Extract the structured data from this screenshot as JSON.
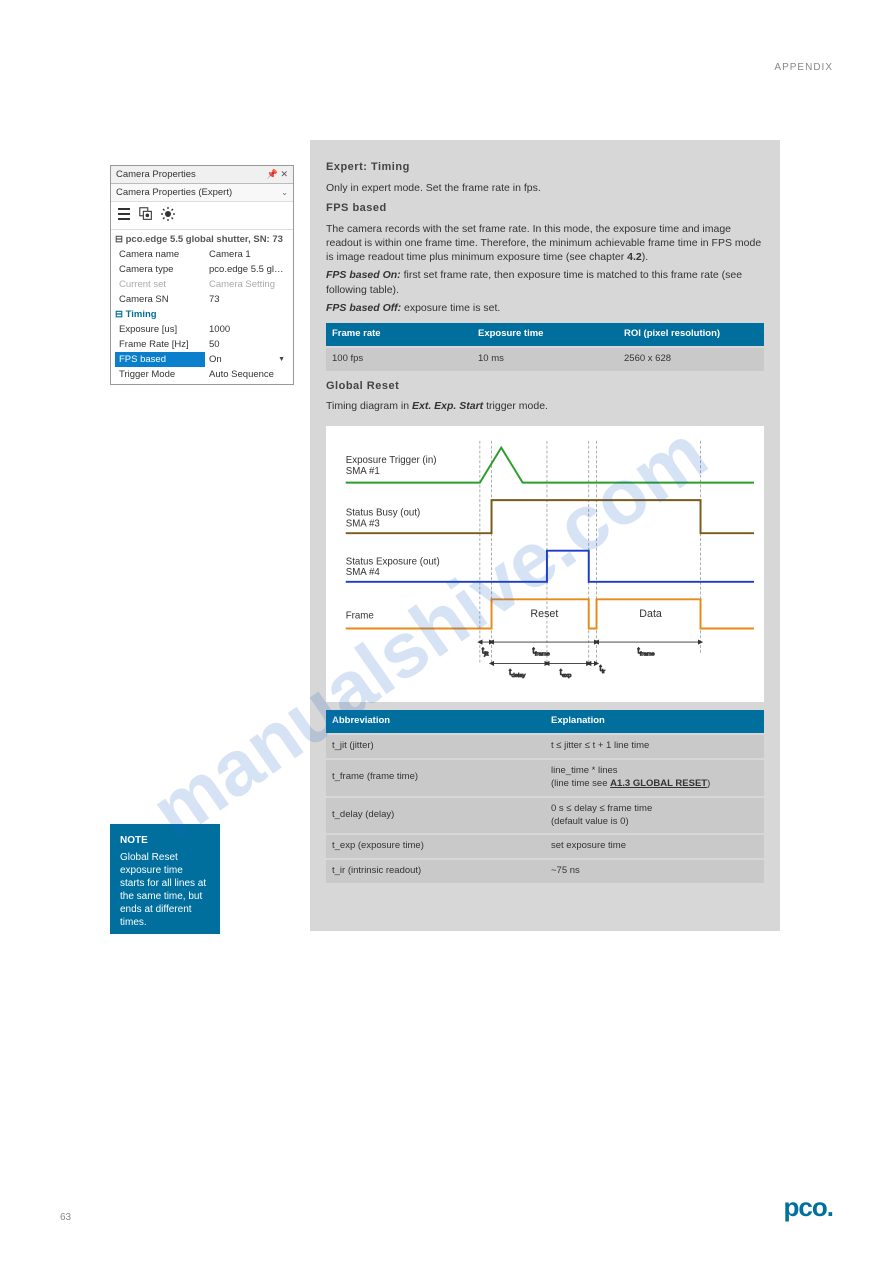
{
  "header": {
    "section_label": "APPENDIX"
  },
  "prop_panel": {
    "title": "Camera Properties",
    "dropdown": "Camera Properties (Expert)",
    "group1_head": "pco.edge 5.5 global shutter, SN: 73",
    "rows1": [
      {
        "label": "Camera name",
        "value": "Camera 1"
      },
      {
        "label": "Camera type",
        "value": "pco.edge 5.5 global..."
      },
      {
        "label": "Current set",
        "value": "Camera Setting",
        "gray": true
      },
      {
        "label": "Camera SN",
        "value": "73"
      }
    ],
    "group2_head": "Timing",
    "rows2": [
      {
        "label": "Exposure [us]",
        "value": "1000"
      },
      {
        "label": "Frame Rate [Hz]",
        "value": "50"
      },
      {
        "label": "FPS based",
        "value": "On",
        "selected": true,
        "dropdown": true
      },
      {
        "label": "Trigger Mode",
        "value": "Auto Sequence"
      }
    ]
  },
  "main": {
    "h_expert": "Expert: Timing",
    "p_expert": "Only in expert mode. Set the frame rate in fps.",
    "h_fps": "FPS based",
    "p_fps": "The camera records with the set frame rate. In this mode, the exposure time and image readout is within one frame time. Therefore, the minimum achievable frame time in FPS mode is image readout time plus minimum exposure time (see chapter ",
    "p_fps_link": "4.2",
    "p_fps_tail": ").",
    "p_fps_on": "FPS based On:",
    "p_fps_on_txt": " first set frame rate, then exposure time is matched to this frame rate (see following table).",
    "p_fps_off": "FPS based Off:",
    "p_fps_off_txt": " exposure time is set.",
    "table1": {
      "headers": [
        "Frame rate",
        "Exposure time",
        "ROI (pixel resolution)"
      ],
      "row": [
        "100 fps",
        "10 ms",
        "2560 x 628"
      ]
    },
    "h_gr": "Global Reset",
    "p_gr": "Timing diagram in ",
    "p_gr_em": "Ext. Exp. Start",
    "p_gr_tail": " trigger mode.",
    "table2": {
      "headers": [
        "Abbreviation",
        "Explanation"
      ],
      "rows": [
        {
          "l": "t_jit (jitter)",
          "r": "t ≤ jitter ≤ t + 1 line time"
        },
        {
          "l": "t_frame (frame time)",
          "r": "line_time * lines\n(line time see A1.3 GLOBAL RESET)"
        },
        {
          "l": "t_delay (delay)",
          "r": "0 s ≤ delay ≤ frame time\n(default value is 0)"
        },
        {
          "l": "t_exp (exposure time)",
          "r": "set exposure time"
        },
        {
          "l": "t_ir (intrinsic readout)",
          "r": "~75 ns"
        }
      ]
    }
  },
  "diagram_labels": {
    "sig1": "Exposure Trigger (in)\nSMA #1",
    "sig2": "Status Busy (out)\nSMA #3",
    "sig3": "Status Exposure (out)\nSMA #4",
    "sig4": "Frame",
    "reset": "Reset",
    "data": "Data",
    "tjit": "t",
    "tjit_sub": "jit",
    "tframe": "t",
    "tframe_sub": "frame",
    "tdelay": "t",
    "tdelay_sub": "delay",
    "texp": "t",
    "texp_sub": "exp",
    "tir": "t",
    "tir_sub": "ir"
  },
  "note": {
    "title": "NOTE",
    "body": "Global Reset exposure time starts for all lines at the same time, but ends at different times."
  },
  "footer": {
    "page": "63",
    "logo": "pco."
  },
  "watermark": "manualshive.com"
}
